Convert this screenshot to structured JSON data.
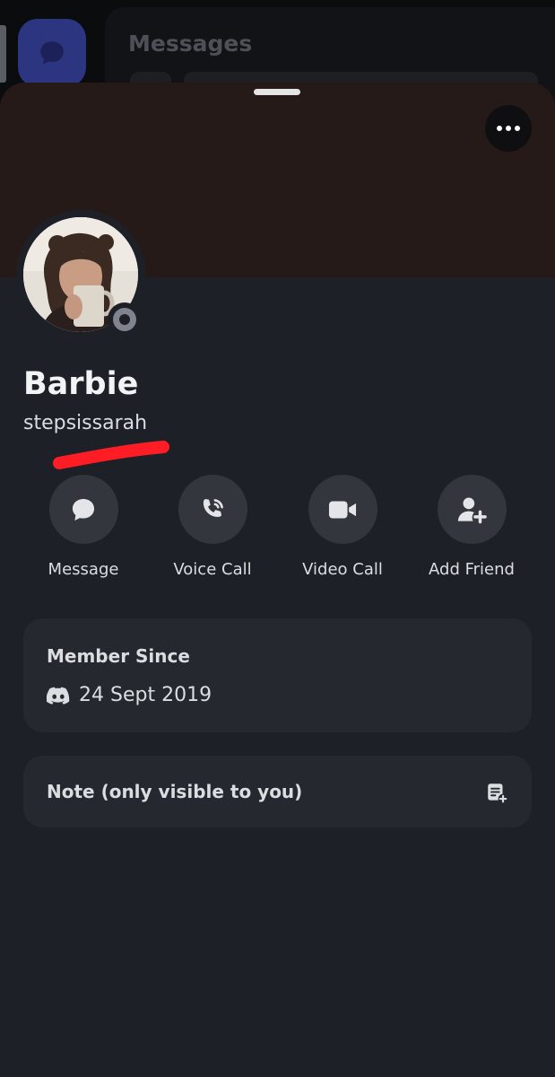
{
  "background": {
    "title": "Messages"
  },
  "profile": {
    "display_name": "Barbie",
    "username": "stepsissarah",
    "status": "offline"
  },
  "actions": [
    {
      "label": "Message",
      "icon": "message-icon"
    },
    {
      "label": "Voice Call",
      "icon": "phone-icon"
    },
    {
      "label": "Video Call",
      "icon": "video-icon"
    },
    {
      "label": "Add Friend",
      "icon": "add-friend-icon"
    }
  ],
  "member_since": {
    "title": "Member Since",
    "date": "24 Sept 2019",
    "icon": "discord-icon"
  },
  "note": {
    "label": "Note (only visible to you)",
    "icon": "note-add-icon"
  },
  "colors": {
    "banner": "#251a18",
    "sheet": "#1e2027",
    "card": "#26282f",
    "button": "#34363e",
    "status_offline": "#80848e",
    "scribble": "#ff1d25"
  }
}
